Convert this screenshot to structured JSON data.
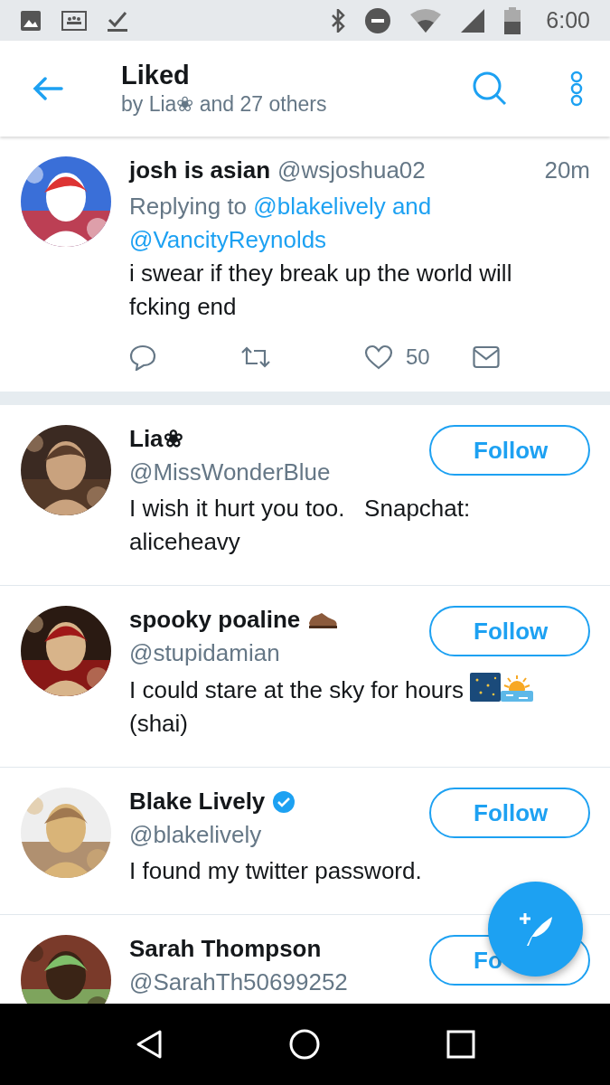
{
  "status_bar": {
    "time": "6:00"
  },
  "header": {
    "title": "Liked",
    "subtitle": "by Lia❀ and 27 others"
  },
  "tweet": {
    "name": "josh is asian",
    "handle": "@wsjoshua02",
    "time": "20m",
    "reply_prefix": "Replying to",
    "reply_targets": [
      "@blakelively and",
      "@VancityReynolds"
    ],
    "text": "i swear if they break up the world will fcking end",
    "like_count": "50"
  },
  "users": [
    {
      "name": "Lia❀",
      "handle": "@MissWonderBlue",
      "bio": "I wish it hurt you too.   Snapchat: aliceheavy",
      "follow": "Follow",
      "verified": false
    },
    {
      "name": "spooky poaline",
      "name_icon": {
        "kind": "shoe"
      },
      "handle": "@stupidamian",
      "bio": "I could stare at the sky for hours",
      "bio_icons": [
        {
          "kind": "night-sky"
        },
        {
          "kind": "sunrise"
        }
      ],
      "bio_tail": "(shai)",
      "follow": "Follow",
      "verified": false
    },
    {
      "name": "Blake Lively",
      "handle": "@blakelively",
      "bio": "I found my twitter password.",
      "follow": "Follow",
      "verified": true
    },
    {
      "name": "Sarah Thompson",
      "handle": "@SarahTh50699252",
      "follow": "Fo",
      "verified": false
    }
  ]
}
